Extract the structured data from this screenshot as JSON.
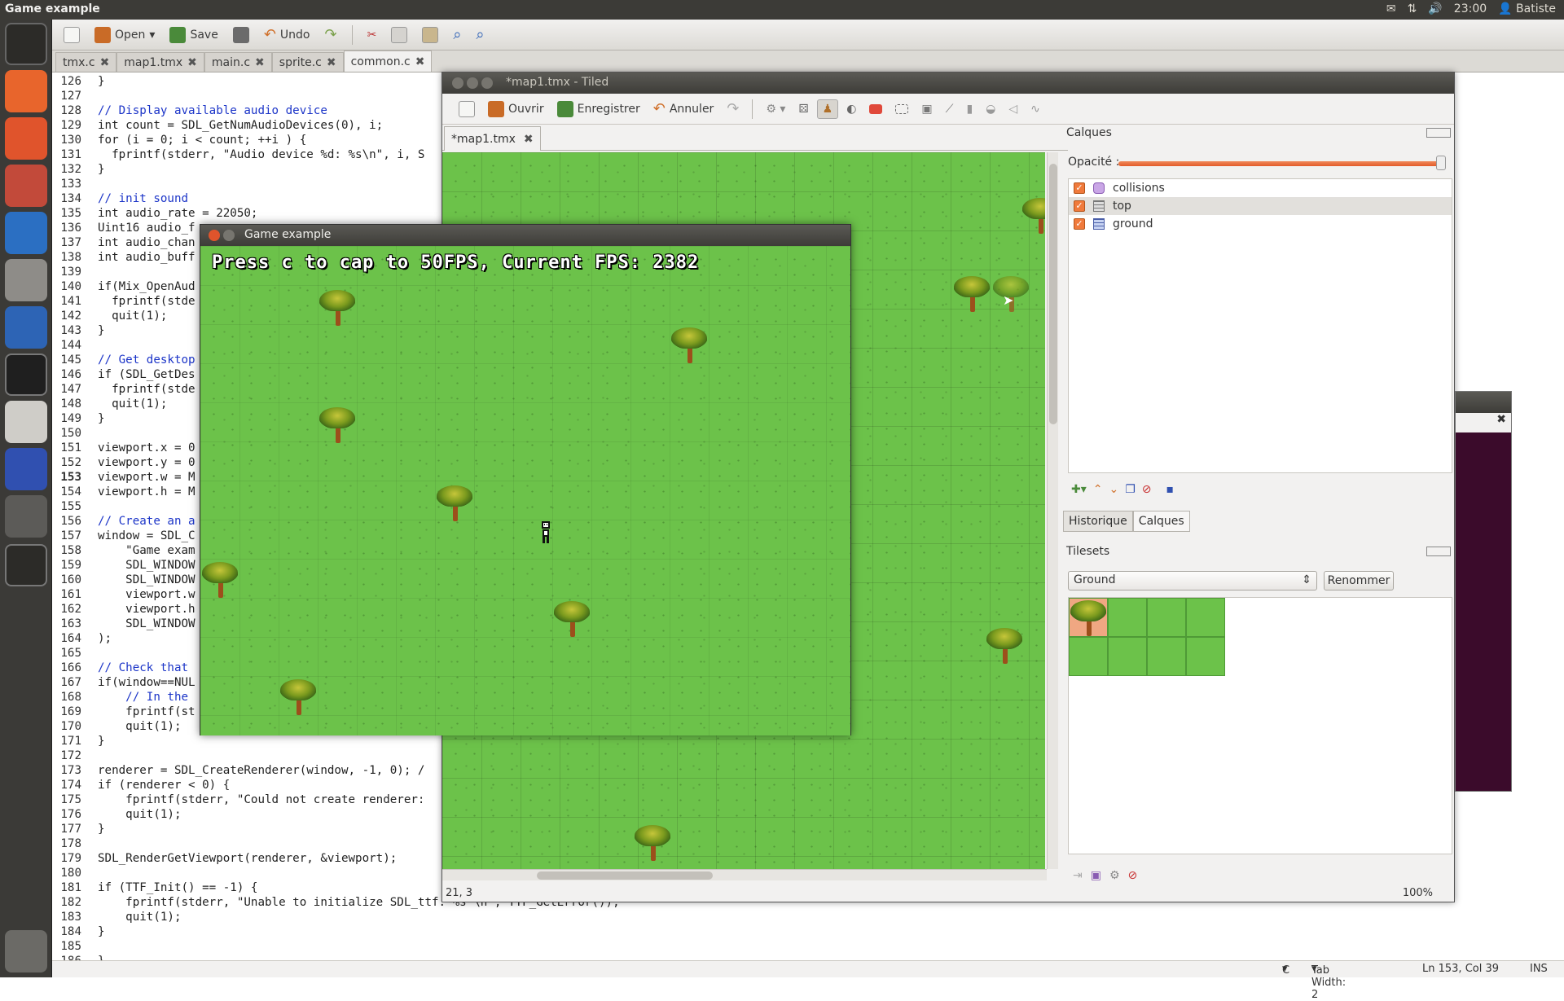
{
  "topbar": {
    "title": "Game example",
    "time": "23:00",
    "user": "Batiste"
  },
  "gedit": {
    "toolbar": {
      "open": "Open",
      "save": "Save",
      "undo": "Undo"
    },
    "tabs": [
      "tmx.c",
      "map1.tmx",
      "main.c",
      "sprite.c",
      "common.c"
    ],
    "code": [
      {
        "n": "126",
        "t": "}"
      },
      {
        "n": "127",
        "t": ""
      },
      {
        "n": "128",
        "t": "// Display available audio device"
      },
      {
        "n": "129",
        "t": "int count = SDL_GetNumAudioDevices(0), i;"
      },
      {
        "n": "130",
        "t": "for (i = 0; i < count; ++i ) {"
      },
      {
        "n": "131",
        "t": "  fprintf(stderr, \"Audio device %d: %s\\n\", i, S"
      },
      {
        "n": "132",
        "t": "}"
      },
      {
        "n": "133",
        "t": ""
      },
      {
        "n": "134",
        "t": "// init sound"
      },
      {
        "n": "135",
        "t": "int audio_rate = 22050;"
      },
      {
        "n": "136",
        "t": "Uint16 audio_f"
      },
      {
        "n": "137",
        "t": "int audio_chan"
      },
      {
        "n": "138",
        "t": "int audio_buff"
      },
      {
        "n": "139",
        "t": ""
      },
      {
        "n": "140",
        "t": "if(Mix_OpenAud"
      },
      {
        "n": "141",
        "t": "  fprintf(stde"
      },
      {
        "n": "142",
        "t": "  quit(1);"
      },
      {
        "n": "143",
        "t": "}"
      },
      {
        "n": "144",
        "t": ""
      },
      {
        "n": "145",
        "t": "// Get desktop"
      },
      {
        "n": "146",
        "t": "if (SDL_GetDes"
      },
      {
        "n": "147",
        "t": "  fprintf(stde"
      },
      {
        "n": "148",
        "t": "  quit(1);"
      },
      {
        "n": "149",
        "t": "}"
      },
      {
        "n": "150",
        "t": ""
      },
      {
        "n": "151",
        "t": "viewport.x = 0"
      },
      {
        "n": "152",
        "t": "viewport.y = 0"
      },
      {
        "n": "153",
        "t": "viewport.w = M"
      },
      {
        "n": "154",
        "t": "viewport.h = M"
      },
      {
        "n": "155",
        "t": ""
      },
      {
        "n": "156",
        "t": "// Create an a"
      },
      {
        "n": "157",
        "t": "window = SDL_C"
      },
      {
        "n": "158",
        "t": "    \"Game exam"
      },
      {
        "n": "159",
        "t": "    SDL_WINDOW"
      },
      {
        "n": "160",
        "t": "    SDL_WINDOW"
      },
      {
        "n": "161",
        "t": "    viewport.w"
      },
      {
        "n": "162",
        "t": "    viewport.h"
      },
      {
        "n": "163",
        "t": "    SDL_WINDOW"
      },
      {
        "n": "164",
        "t": ");"
      },
      {
        "n": "165",
        "t": ""
      },
      {
        "n": "166",
        "t": "// Check that"
      },
      {
        "n": "167",
        "t": "if(window==NUL"
      },
      {
        "n": "168",
        "t": "    // In the"
      },
      {
        "n": "169",
        "t": "    fprintf(st"
      },
      {
        "n": "170",
        "t": "    quit(1);"
      },
      {
        "n": "171",
        "t": "}"
      },
      {
        "n": "172",
        "t": ""
      },
      {
        "n": "173",
        "t": "renderer = SDL_CreateRenderer(window, -1, 0); /"
      },
      {
        "n": "174",
        "t": "if (renderer < 0) {"
      },
      {
        "n": "175",
        "t": "    fprintf(stderr, \"Could not create renderer:"
      },
      {
        "n": "176",
        "t": "    quit(1);"
      },
      {
        "n": "177",
        "t": "}"
      },
      {
        "n": "178",
        "t": ""
      },
      {
        "n": "179",
        "t": "SDL_RenderGetViewport(renderer, &viewport);"
      },
      {
        "n": "180",
        "t": ""
      },
      {
        "n": "181",
        "t": "if (TTF_Init() == -1) {"
      },
      {
        "n": "182",
        "t": "    fprintf(stderr, \"Unable to initialize SDL_ttf: %s \\n\", TTF_GetError());"
      },
      {
        "n": "183",
        "t": "    quit(1);"
      },
      {
        "n": "184",
        "t": "}"
      },
      {
        "n": "185",
        "t": ""
      },
      {
        "n": "186",
        "t": "}"
      }
    ],
    "status": {
      "lang": "C",
      "tab_width": "Tab Width: 2",
      "position": "Ln 153, Col 39",
      "mode": "INS"
    }
  },
  "tiled": {
    "title": "*map1.tmx - Tiled",
    "toolbar": {
      "open": "Ouvrir",
      "save": "Enregistrer",
      "undo": "Annuler"
    },
    "map_tab": "*map1.tmx",
    "coords": "21, 3",
    "zoom": "100%",
    "layers_panel": {
      "title": "Calques",
      "opacity_label": "Opacité :",
      "opacity": 1.0,
      "layers": [
        {
          "name": "collisions",
          "visible": true,
          "selected": false,
          "icon": "object-layer-icon"
        },
        {
          "name": "top",
          "visible": true,
          "selected": true,
          "icon": "tile-layer-icon"
        },
        {
          "name": "ground",
          "visible": true,
          "selected": false,
          "icon": "tile-layer-icon"
        }
      ]
    },
    "panel_tabs": [
      "Historique",
      "Calques"
    ],
    "tilesets_panel": {
      "title": "Tilesets",
      "selected": "Ground",
      "rename": "Renommer"
    }
  },
  "game": {
    "title": "Game example",
    "fps_text": "Press c to cap to 50FPS, Current FPS: 2382"
  },
  "colors": {
    "grass": "#6cc24a",
    "accent": "#f07a3c",
    "terminal": "#3b0b2b"
  }
}
